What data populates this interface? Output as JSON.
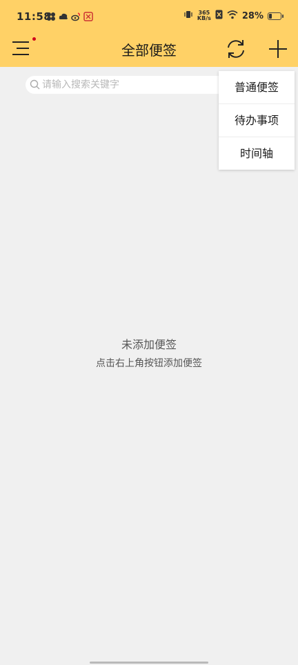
{
  "status_bar": {
    "time": "11:58",
    "net_speed_value": "365",
    "net_speed_unit": "KB/s",
    "battery_level": "28%",
    "battery_fraction": 0.28
  },
  "header": {
    "title": "全部便签",
    "menu_icon": "menu-icon",
    "sync_icon": "sync-icon",
    "add_icon": "plus-icon",
    "background_color": "#ffd166",
    "notification_dot_color": "#d0021b"
  },
  "search": {
    "placeholder": "请输入搜索关键字",
    "value": "",
    "icon": "search-icon"
  },
  "dropdown": {
    "items": [
      {
        "label": "普通便签"
      },
      {
        "label": "待办事项"
      },
      {
        "label": "时间轴"
      }
    ]
  },
  "empty_state": {
    "title": "未添加便签",
    "subtitle": "点击右上角按钮添加便签"
  }
}
